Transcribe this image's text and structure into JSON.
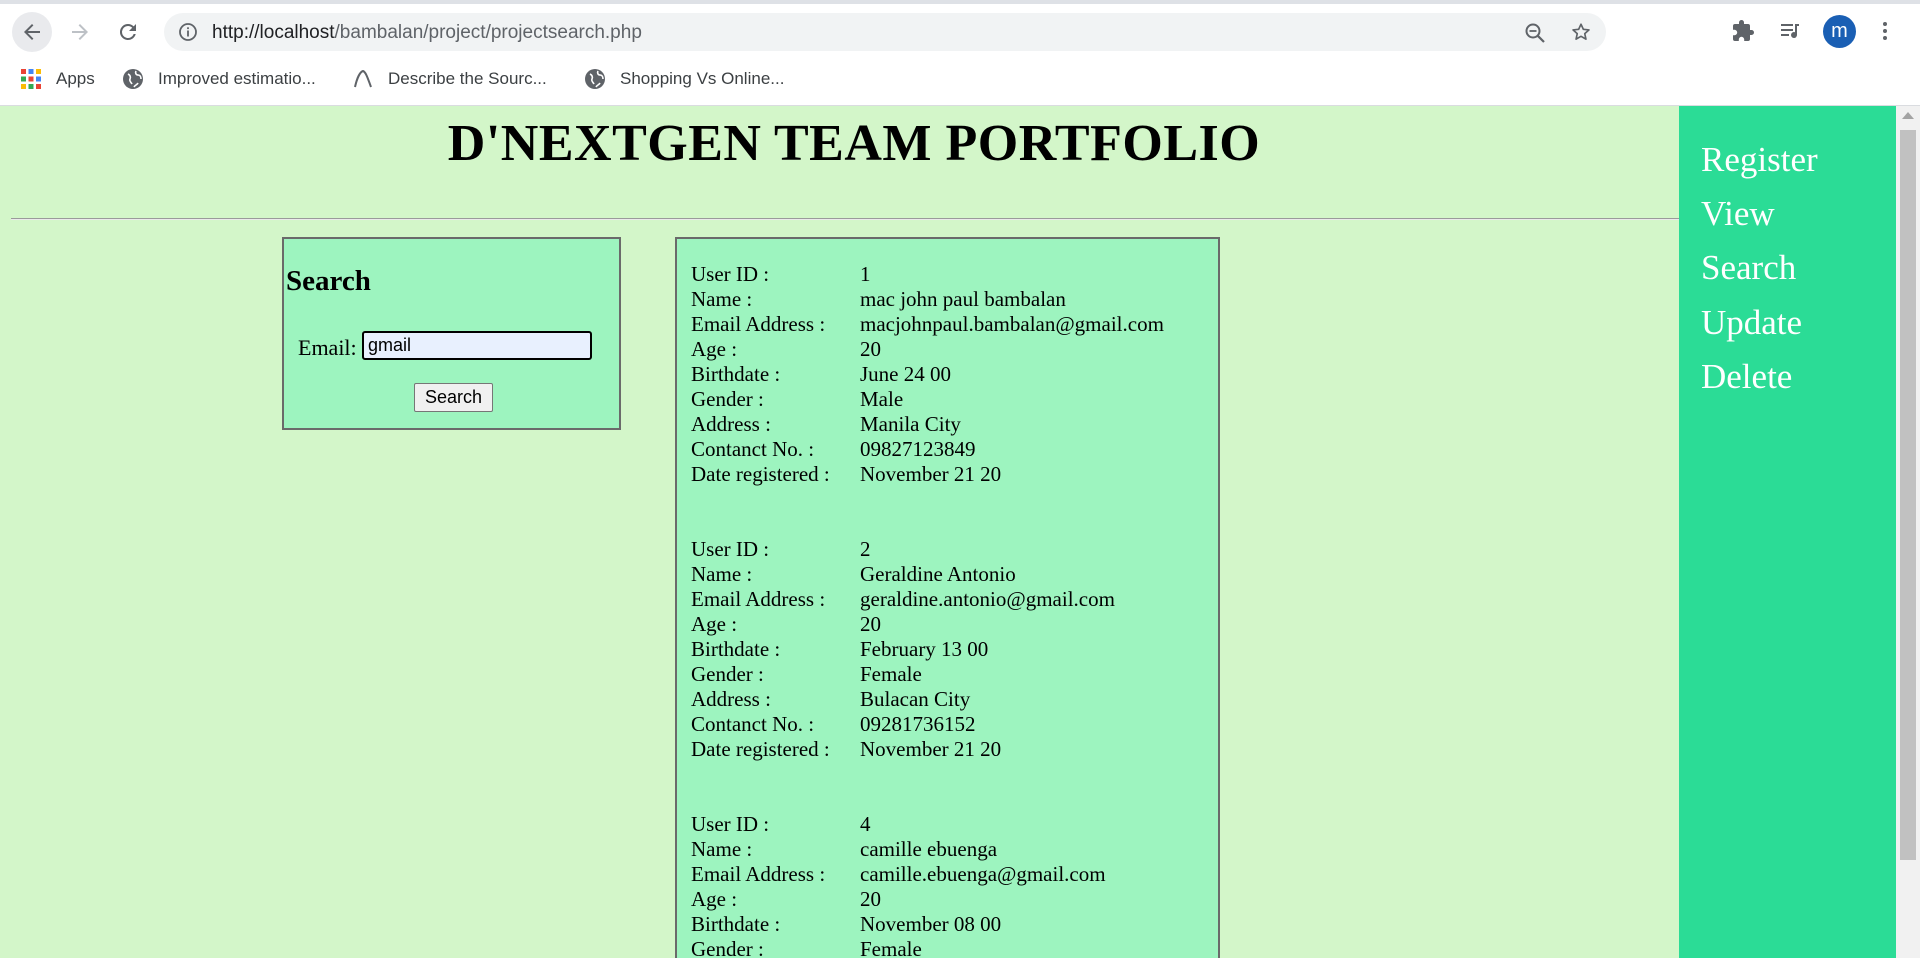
{
  "browser": {
    "url_host": "http://localhost",
    "url_path": "/bambalan/project/projectsearch.php",
    "avatar_letter": "m",
    "bookmarks": [
      {
        "label": "Apps",
        "icon": "apps-grid-icon"
      },
      {
        "label": "Improved estimatio...",
        "icon": "globe-icon"
      },
      {
        "label": "Describe the Sourc...",
        "icon": "bookmark-favicon"
      },
      {
        "label": "Shopping Vs Online...",
        "icon": "globe-icon"
      }
    ]
  },
  "page": {
    "title": "D'NEXTGEN TEAM PORTFOLIO"
  },
  "search_panel": {
    "heading": "Search",
    "email_label": "Email:",
    "email_value": "gmail",
    "button_label": "Search"
  },
  "results": {
    "labels": {
      "user_id": "User ID :",
      "name": "Name :",
      "email": "Email Address :",
      "age": "Age :",
      "birthdate": "Birthdate :",
      "gender": "Gender :",
      "address": "Address :",
      "contact": "Contanct No. :",
      "date_registered": "Date registered :"
    },
    "records": [
      {
        "user_id": "1",
        "name": "mac john paul bambalan",
        "email": "macjohnpaul.bambalan@gmail.com",
        "age": "20",
        "birthdate": "June 24 00",
        "gender": "Male",
        "address": "Manila City",
        "contact": "09827123849",
        "date_registered": "November 21 20"
      },
      {
        "user_id": "2",
        "name": "Geraldine Antonio",
        "email": "geraldine.antonio@gmail.com",
        "age": "20",
        "birthdate": "February 13 00",
        "gender": "Female",
        "address": "Bulacan City",
        "contact": "09281736152",
        "date_registered": "November 21 20"
      },
      {
        "user_id": "4",
        "name": "camille ebuenga",
        "email": "camille.ebuenga@gmail.com",
        "age": "20",
        "birthdate": "November 08 00",
        "gender": "Female"
      }
    ]
  },
  "nav": {
    "items": [
      "Register",
      "View",
      "Search",
      "Update",
      "Delete"
    ]
  },
  "colors": {
    "page_bg": "#d3f6c9",
    "panel_bg": "#9df4bf",
    "nav_bg": "#2bdc96",
    "nav_text": "#ffffff"
  }
}
